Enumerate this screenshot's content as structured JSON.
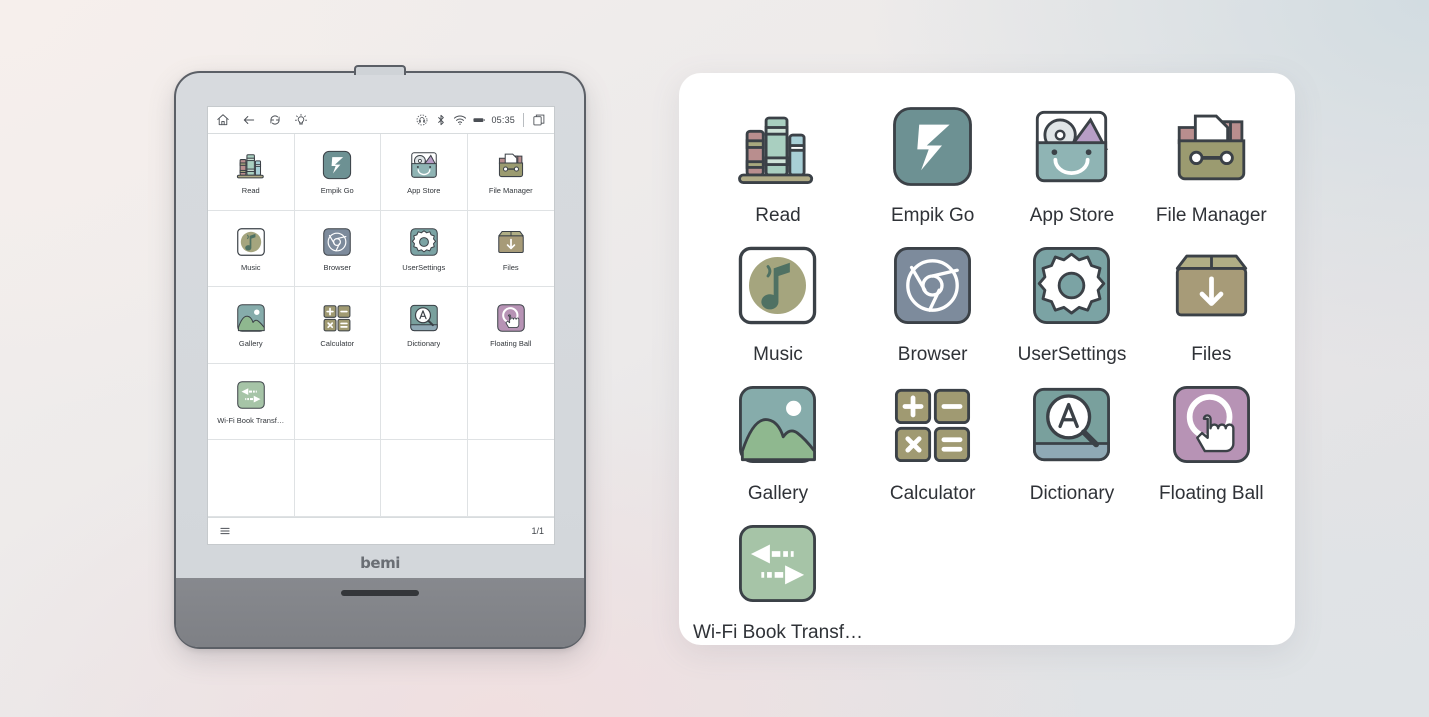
{
  "device": {
    "brand": "bemi",
    "statusbar": {
      "nav_icons": [
        {
          "name": "home-icon",
          "label": "Home"
        },
        {
          "name": "back-arrow-icon",
          "label": "Back"
        },
        {
          "name": "refresh-icon",
          "label": "Refresh"
        },
        {
          "name": "frontlight-icon",
          "label": "Front light"
        }
      ],
      "status_icons": [
        {
          "name": "headphone-icon",
          "label": "Audio"
        },
        {
          "name": "bluetooth-icon",
          "label": "Bluetooth"
        },
        {
          "name": "wifi-icon",
          "label": "Wi-Fi"
        },
        {
          "name": "battery-icon",
          "label": "Battery"
        }
      ],
      "time": "05:35",
      "multitask_icon": "copy-windows-icon"
    },
    "bottombar": {
      "menu_icon": "hamburger-menu-icon",
      "page_indicator": "1/1"
    }
  },
  "apps": [
    {
      "name": "Read",
      "icon": "read-books-icon",
      "short": "Read"
    },
    {
      "name": "Empik Go",
      "icon": "empik-go-icon",
      "short": "Empik Go"
    },
    {
      "name": "App Store",
      "icon": "app-store-bag-icon",
      "short": "App Store"
    },
    {
      "name": "File Manager",
      "icon": "file-manager-icon",
      "short": "File Manager"
    },
    {
      "name": "Music",
      "icon": "music-note-icon",
      "short": "Music"
    },
    {
      "name": "Browser",
      "icon": "browser-chrome-icon",
      "short": "Browser"
    },
    {
      "name": "UserSettings",
      "icon": "gear-settings-icon",
      "short": "UserSettings"
    },
    {
      "name": "Files",
      "icon": "files-box-down-icon",
      "short": "Files"
    },
    {
      "name": "Gallery",
      "icon": "gallery-picture-icon",
      "short": "Gallery"
    },
    {
      "name": "Calculator",
      "icon": "calculator-icon",
      "short": "Calculator"
    },
    {
      "name": "Dictionary",
      "icon": "dictionary-icon",
      "short": "Dictionary"
    },
    {
      "name": "Floating Ball",
      "icon": "floating-ball-icon",
      "short": "Floating Ball"
    },
    {
      "name": "Wi-Fi Book Transf…",
      "icon": "wifi-transfer-icon",
      "short": "Wi-Fi Book Transf…"
    }
  ],
  "grid": {
    "columns": 4,
    "rows": 5,
    "empty_cells": 7
  },
  "colors": {
    "empik_teal": "#6d9193",
    "browser_blue": "#7d8b9c",
    "settings_teal": "#7ba3a4",
    "files_tan": "#a79b78",
    "gallery_blue": "#86acab",
    "calculator_khaki": "#a09a72",
    "dictionary_teal": "#79a09d",
    "floating_purple": "#b793b5",
    "transfer_green": "#a6c4a7",
    "music_olive": "#a5a57e",
    "file_manager_olive": "#9b9b70",
    "outline": "#3b4147",
    "panel_bg": "#ffffff",
    "bezel": "#d5d9dd"
  }
}
